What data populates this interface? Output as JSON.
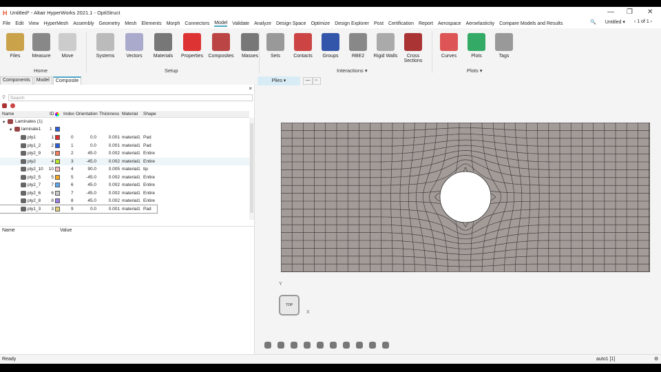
{
  "window": {
    "logo": "H",
    "title": "Untitled* - Altair HyperWorks 2021.1 - OptiStruct",
    "minimize": "—",
    "restore": "❐",
    "close": "✕"
  },
  "menu": [
    "File",
    "Edit",
    "View",
    "HyperMesh",
    "Assembly",
    "Geometry",
    "Mesh",
    "Elements",
    "Morph",
    "Connectors",
    "Model",
    "Validate",
    "Analyze",
    "Design Space",
    "Optimize",
    "Design Explorer",
    "Post",
    "Certification",
    "Report",
    "Aerospace",
    "Aeroelasticity",
    "Compare Models and Results"
  ],
  "menu_active": "Model",
  "menu_right": {
    "search_icon": "🔍",
    "session": "Untitled ▾",
    "page": "‹ 1 of 1 ›"
  },
  "ribbon": {
    "home": {
      "label": "Home",
      "tools": [
        "Files",
        "Measure",
        "Move"
      ]
    },
    "setup": {
      "label": "Setup",
      "tools": [
        "Systems",
        "Vectors",
        "Materials",
        "Properties",
        "Composites",
        "Masses"
      ]
    },
    "interactions": {
      "label": "Interactions ▾",
      "tools": [
        "Sets",
        "Contacts",
        "Groups",
        "RBE2",
        "Rigid Walls",
        "Cross Sections"
      ]
    },
    "plots": {
      "label": "Plots ▾",
      "tools": [
        "Curves",
        "Plots",
        "Tags"
      ]
    }
  },
  "panel_tabs": [
    "Components",
    "Model",
    "Composite"
  ],
  "search_placeholder": "Search",
  "columns": [
    "Name",
    "ID",
    "Index",
    "Orientation",
    "Thickness",
    "Material",
    "Shape"
  ],
  "tree": {
    "root": "Laminates (1)",
    "laminate": {
      "name": "laminate1",
      "id": "1",
      "color": "#2b5fd9"
    }
  },
  "plies": [
    {
      "name": "ply1",
      "id": "1",
      "color": "#d8302a",
      "index": "0",
      "orientation": "0.0",
      "thickness": "0.001",
      "material": "material1",
      "shape": "Pad"
    },
    {
      "name": "ply1_2",
      "id": "2",
      "color": "#2b5fd9",
      "index": "1",
      "orientation": "0.0",
      "thickness": "0.001",
      "material": "material1",
      "shape": "Pad"
    },
    {
      "name": "ply2_9",
      "id": "9",
      "color": "#f07e5e",
      "index": "2",
      "orientation": "45.0",
      "thickness": "0.002",
      "material": "material1",
      "shape": "Entire"
    },
    {
      "name": "ply2",
      "id": "4",
      "color": "#b6e02c",
      "index": "3",
      "orientation": "-45.0",
      "thickness": "0.002",
      "material": "material1",
      "shape": "Entire"
    },
    {
      "name": "ply2_10",
      "id": "10",
      "color": "#f4b8b8",
      "index": "4",
      "orientation": "90.0",
      "thickness": "0.005",
      "material": "material1",
      "shape": "tip"
    },
    {
      "name": "ply2_5",
      "id": "5",
      "color": "#f5a623",
      "index": "5",
      "orientation": "-45.0",
      "thickness": "0.002",
      "material": "material1",
      "shape": "Entire"
    },
    {
      "name": "ply2_7",
      "id": "7",
      "color": "#5aa9ee",
      "index": "6",
      "orientation": "45.0",
      "thickness": "0.002",
      "material": "material1",
      "shape": "Entire"
    },
    {
      "name": "ply2_6",
      "id": "6",
      "color": "#c8c8c8",
      "index": "7",
      "orientation": "-45.0",
      "thickness": "0.002",
      "material": "material1",
      "shape": "Entire"
    },
    {
      "name": "ply2_8",
      "id": "8",
      "color": "#9b7ee6",
      "index": "8",
      "orientation": "45.0",
      "thickness": "0.002",
      "material": "material1",
      "shape": "Entire"
    },
    {
      "name": "ply1_3",
      "id": "3",
      "color": "#e6cf7a",
      "index": "9",
      "orientation": "0.0",
      "thickness": "0.001",
      "material": "material1",
      "shape": "Pad"
    }
  ],
  "props_columns": [
    "Name",
    "Value"
  ],
  "viewport": {
    "selector": "Plies ▾",
    "axis_y": "Y",
    "axis_x": "X",
    "viewcube": "TOP",
    "mesh_color": "#a39b98"
  },
  "status": {
    "left": "Ready",
    "right": "auto1 [1]"
  }
}
